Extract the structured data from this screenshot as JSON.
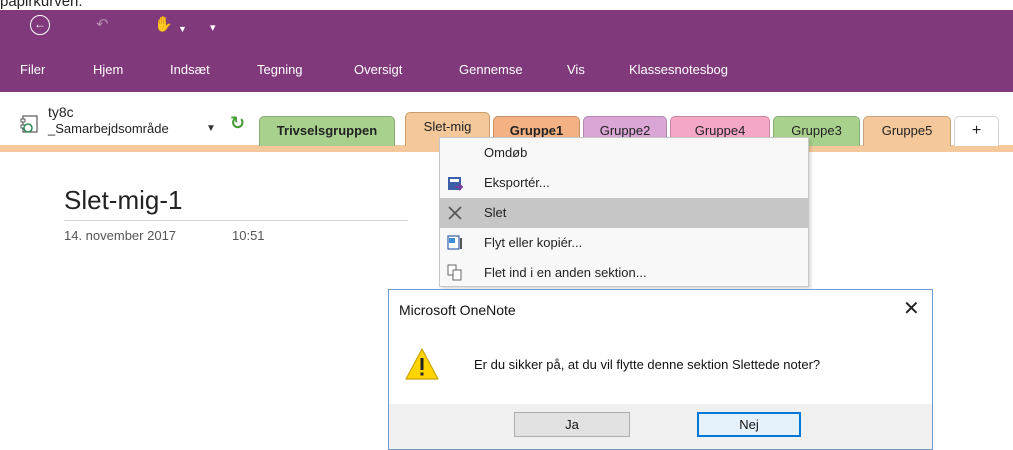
{
  "top_text": "papirkurven.",
  "ribbon": {
    "tabs": [
      "Filer",
      "Hjem",
      "Indsæt",
      "Tegning",
      "Oversigt",
      "Gennemse",
      "Vis",
      "Klassesnotesbog"
    ]
  },
  "notebook": {
    "name": "ty8c",
    "section_group": "_Samarbejdsområde"
  },
  "section_tabs": [
    {
      "label": "Trivselsgruppen",
      "color": "#a9d18e"
    },
    {
      "label": "Slet-mig",
      "color": "#f4c89a"
    },
    {
      "label": "Gruppe1",
      "color": "#f4b183"
    },
    {
      "label": "Gruppe2",
      "color": "#d9a6d6"
    },
    {
      "label": "Gruppe4",
      "color": "#f4a7c6"
    },
    {
      "label": "Gruppe3",
      "color": "#a9d18e"
    },
    {
      "label": "Gruppe5",
      "color": "#f4c89a"
    },
    {
      "label": "+",
      "color": "#ffffff"
    }
  ],
  "page": {
    "title": "Slet-mig-1",
    "date": "14. november 2017",
    "time": "10:51"
  },
  "context_menu": {
    "items": [
      "Omdøb",
      "Eksportér...",
      "Slet",
      "Flyt eller kopiér...",
      "Flet ind i en anden sektion..."
    ],
    "highlighted": "Slet"
  },
  "dialog": {
    "title": "Microsoft OneNote",
    "message": "Er du sikker på, at du vil flytte denne sektion Slettede noter?",
    "yes_label": "Ja",
    "no_label": "Nej",
    "accent": "#0078d7"
  },
  "colors": {
    "ribbon": "#80397b",
    "section_strip": "#f4c89a"
  }
}
